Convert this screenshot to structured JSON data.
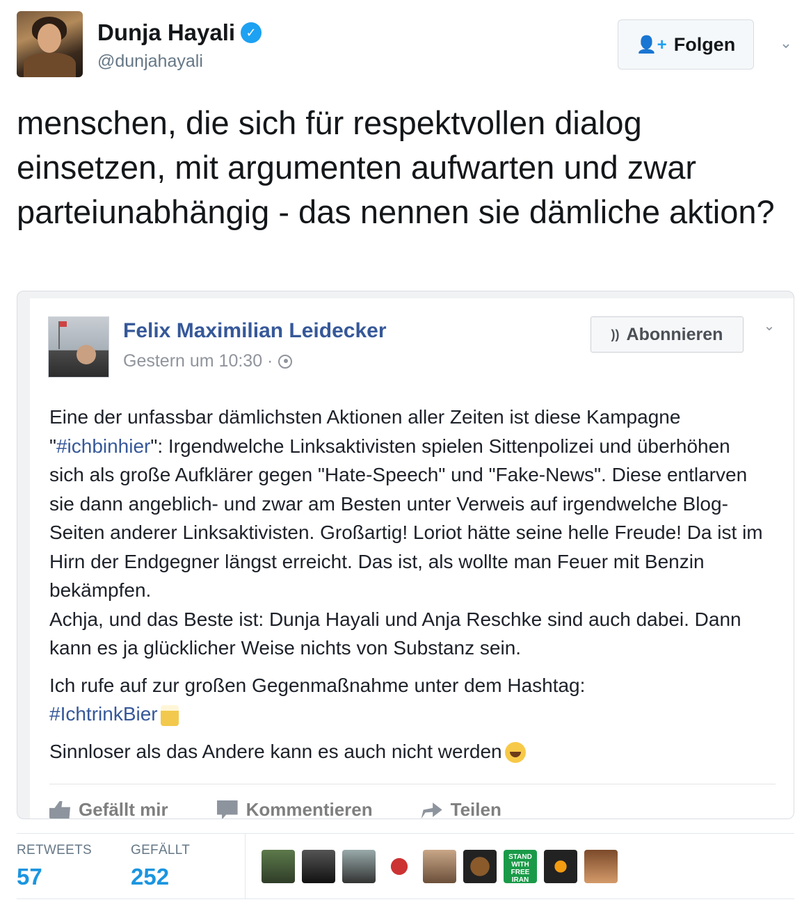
{
  "tweet": {
    "author_name": "Dunja Hayali",
    "author_handle": "@dunjahayali",
    "verified_icon": "verified-badge-icon",
    "follow_label": "Folgen",
    "follow_icon": "add-user-icon",
    "text": "menschen, die sich für respektvollen dialog einsetzen, mit argumenten aufwarten und zwar parteiunabhängig - das nennen sie dämliche aktion?"
  },
  "fb_post": {
    "author": "Felix Maximilian Leidecker",
    "timestamp": "Gestern um 10:30 ·",
    "subscribe_label": "Abonnieren",
    "paragraph1_a": "Eine der unfassbar dämlichsten Aktionen aller Zeiten ist diese Kampagne \"",
    "paragraph1_hashtag": "#ichbinhier",
    "paragraph1_b": "\": Irgendwelche Linksaktivisten spielen Sittenpolizei und überhöhen sich als große Aufklärer gegen \"Hate-Speech\" und \"Fake-News\". Diese entlarven sie dann angeblich- und zwar am Besten unter Verweis auf irgendwelche Blog-Seiten anderer Linksaktivisten. Großartig! Loriot hätte seine helle Freude! Da ist im Hirn der Endgegner längst erreicht. Das ist, als wollte man Feuer mit Benzin bekämpfen.",
    "paragraph1_c": "Achja, und das Beste ist: Dunja Hayali und Anja Reschke sind auch dabei. Dann kann es ja glücklicher Weise nichts von Substanz sein.",
    "paragraph2": "Ich rufe auf zur großen Gegenmaßnahme unter dem Hashtag:",
    "paragraph2_hashtag": "#IchtrinkBier",
    "paragraph3": "Sinnloser als das Andere kann es auch nicht werden",
    "actions": {
      "like": "Gefällt mir",
      "comment": "Kommentieren",
      "share": "Teilen"
    }
  },
  "stats": {
    "retweets_label": "RETWEETS",
    "retweets_value": "57",
    "likes_label": "GEFÄLLT",
    "likes_value": "252",
    "liker_badge_text": "STAND WITH FREE IRAN"
  },
  "colors": {
    "twitter_blue": "#1da1f2",
    "stat_blue": "#1b95e0",
    "facebook_blue": "#365899"
  }
}
